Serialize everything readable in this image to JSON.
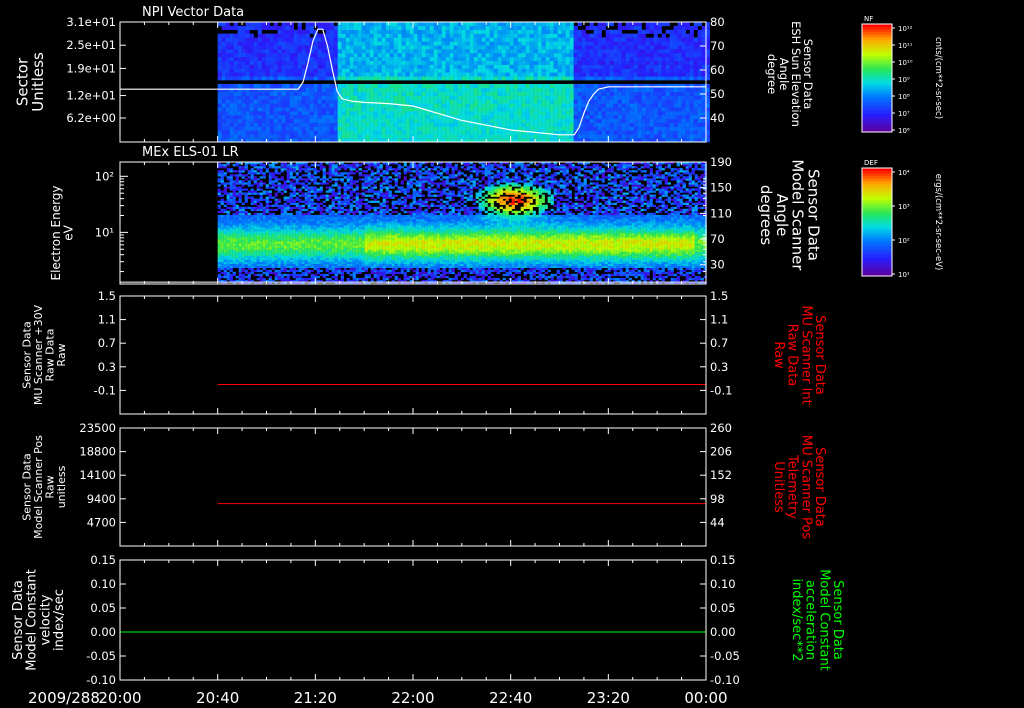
{
  "colors": {
    "background": "#000000",
    "axis": "#ffffff",
    "red_trace": "#ff0000",
    "green_trace": "#00ff00",
    "white_trace": "#ffffff"
  },
  "x_axis": {
    "date_label": "2009/288",
    "ticks": [
      "20:00",
      "20:40",
      "21:20",
      "22:00",
      "22:40",
      "23:20",
      "00:00"
    ],
    "range_minutes": [
      0,
      240
    ]
  },
  "chart_data": [
    {
      "type": "heatmap",
      "title": "NPI Vector Data",
      "left_axis": {
        "label_lines": [
          "Sector",
          "Unitless"
        ],
        "ticks": [
          "3.1e+01",
          "2.5e+01",
          "1.9e+01",
          "1.2e+01",
          "6.2e+00"
        ],
        "tick_values": [
          31,
          25,
          19,
          12,
          6.2
        ],
        "range": [
          0,
          31
        ]
      },
      "right_axis": {
        "label_lines": [
          "Sensor Data",
          "ESH Sun Elevation",
          "Angle",
          "degree"
        ],
        "ticks": [
          "80",
          "70",
          "60",
          "50",
          "40"
        ],
        "tick_values": [
          80,
          70,
          60,
          50,
          40
        ],
        "range": [
          30,
          80
        ]
      },
      "data_start_minute": 40,
      "data_gap_sectors": [
        14.5,
        16.5
      ],
      "colorbar": {
        "label": "NF",
        "units": "cnts/(cm**2-sr-sec)",
        "ticks": [
          "10¹²",
          "10¹¹",
          "10¹⁰",
          "10⁹",
          "10⁸",
          "10⁷",
          "10⁶"
        ]
      },
      "series": [
        {
          "name": "Sun Elevation Angle",
          "color": "#ffffff",
          "x_minutes": [
            0,
            39,
            40,
            73,
            75,
            77,
            79,
            81,
            83,
            85,
            87,
            89,
            91,
            95,
            100,
            110,
            120,
            130,
            140,
            150,
            160,
            170,
            180,
            186,
            188,
            190,
            192,
            194,
            196,
            200,
            210,
            220,
            230,
            240
          ],
          "y": [
            52,
            52,
            52,
            52,
            55,
            63,
            72,
            77,
            77,
            70,
            60,
            51,
            48,
            47,
            46.5,
            46,
            45,
            42,
            39,
            37,
            35,
            34,
            33,
            33,
            36,
            42,
            47,
            50,
            52,
            53,
            53,
            53,
            53,
            53
          ]
        }
      ]
    },
    {
      "type": "heatmap",
      "title": "MEx ELS-01 LR",
      "left_axis": {
        "label_lines": [
          "Electron Energy",
          "eV"
        ],
        "ticks": [
          "10²",
          "10¹"
        ],
        "scale": "log",
        "range": [
          1.2,
          180
        ]
      },
      "right_axis": {
        "label_lines": [
          "Sensor Data",
          "Model Scanner",
          "Angle",
          "degrees"
        ],
        "ticks": [
          "190",
          "150",
          "110",
          "70",
          "30"
        ],
        "tick_values": [
          190,
          150,
          110,
          70,
          30
        ],
        "range": [
          0,
          190
        ]
      },
      "data_start_minute": 40,
      "colorbar": {
        "label": "DEF",
        "units": "ergs/(cm**2-sr-sec-eV)",
        "ticks": [
          "10⁴",
          "10³",
          "10²",
          "10¹"
        ]
      },
      "series": [
        {
          "name": "Scanner Angle",
          "color": "#ffffff",
          "x_minutes": [
            0,
            240
          ],
          "y": [
            3,
            3
          ]
        }
      ]
    },
    {
      "type": "line",
      "left_axis": {
        "label_lines": [
          "Sensor Data",
          "MU Scanner +30V",
          "Raw Data",
          "Raw"
        ],
        "ticks": [
          "1.5",
          "1.1",
          "0.7",
          "0.3",
          "-0.1"
        ],
        "tick_values": [
          1.5,
          1.1,
          0.7,
          0.3,
          -0.1
        ],
        "range": [
          -0.5,
          1.5
        ]
      },
      "right_axis": {
        "label_lines": [
          "Sensor Data",
          "MU Scanner Int",
          "Raw Data",
          "Raw"
        ],
        "label_color": "#ff0000",
        "ticks": [
          "1.5",
          "1.1",
          "0.7",
          "0.3",
          "-0.1"
        ],
        "tick_values": [
          1.5,
          1.1,
          0.7,
          0.3,
          -0.1
        ],
        "range": [
          -0.5,
          1.5
        ]
      },
      "series": [
        {
          "name": "MU Scanner Int",
          "color": "#ff0000",
          "x_minutes": [
            40,
            240
          ],
          "y": [
            0,
            0
          ]
        }
      ]
    },
    {
      "type": "line",
      "left_axis": {
        "label_lines": [
          "Sensor Data",
          "Model Scanner Pos",
          "Raw",
          "unitless"
        ],
        "ticks": [
          "23500",
          "18800",
          "14100",
          "9400",
          "4700"
        ],
        "tick_values": [
          23500,
          18800,
          14100,
          9400,
          4700
        ],
        "range": [
          0,
          23500
        ]
      },
      "right_axis": {
        "label_lines": [
          "Sensor Data",
          "MU Scanner Pos",
          "Telemetry",
          "Unitless"
        ],
        "label_color": "#ff0000",
        "ticks": [
          "260",
          "206",
          "152",
          "98",
          "44"
        ],
        "tick_values": [
          260,
          206,
          152,
          98,
          44
        ],
        "range": [
          -10,
          260
        ]
      },
      "series": [
        {
          "name": "MU Scanner Pos",
          "color": "#ff0000",
          "x_minutes": [
            40,
            240
          ],
          "y": [
            87,
            87
          ]
        }
      ]
    },
    {
      "type": "line",
      "left_axis": {
        "label_lines": [
          "Sensor Data",
          "Model Constant",
          "velocity",
          "index/sec"
        ],
        "ticks": [
          "0.15",
          "0.10",
          "0.05",
          "0.00",
          "-0.05",
          "-0.10"
        ],
        "tick_values": [
          0.15,
          0.1,
          0.05,
          0.0,
          -0.05,
          -0.1
        ],
        "range": [
          -0.1,
          0.15
        ]
      },
      "right_axis": {
        "label_lines": [
          "Sensor Data",
          "Model Constant",
          "acceleration",
          "index/sec**2"
        ],
        "label_color": "#00ff00",
        "ticks": [
          "0.15",
          "0.10",
          "0.05",
          "0.00",
          "-0.05",
          "-0.10"
        ],
        "tick_values": [
          0.15,
          0.1,
          0.05,
          0.0,
          -0.05,
          -0.1
        ],
        "range": [
          -0.1,
          0.15
        ]
      },
      "series": [
        {
          "name": "Model Constant acceleration",
          "color": "#00ff00",
          "x_minutes": [
            0,
            240
          ],
          "y": [
            0,
            0
          ]
        }
      ]
    }
  ]
}
